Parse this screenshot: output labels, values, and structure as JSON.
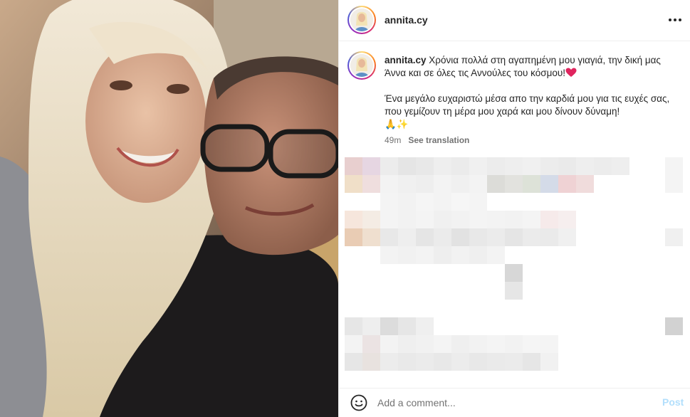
{
  "post": {
    "username": "annita.cy",
    "caption_line1": "Χρόνια πολλά στη αγαπημένη μου γιαγιά, την δική μας Άννα και σε όλες τις Αννούλες του κόσμου!",
    "caption_line2": "Ένα μεγάλο ευχαριστώ μέσα απο την καρδιά μου για τις ευχές σας, που γεμίζουν τη μέρα μου χαρά και μου δίνουν δύναμη!",
    "emoji_end": "🙏✨",
    "time": "49m",
    "see_translation": "See translation"
  },
  "comment_box": {
    "placeholder": "Add a comment...",
    "post_label": "Post"
  },
  "icons": {
    "more": "more-options-icon",
    "emoji": "emoji-smiley-icon",
    "heart": "red-heart-emoji"
  },
  "colors": {
    "accent_post": "#b2dffc",
    "heart": "#e0245e",
    "muted": "#737373"
  }
}
